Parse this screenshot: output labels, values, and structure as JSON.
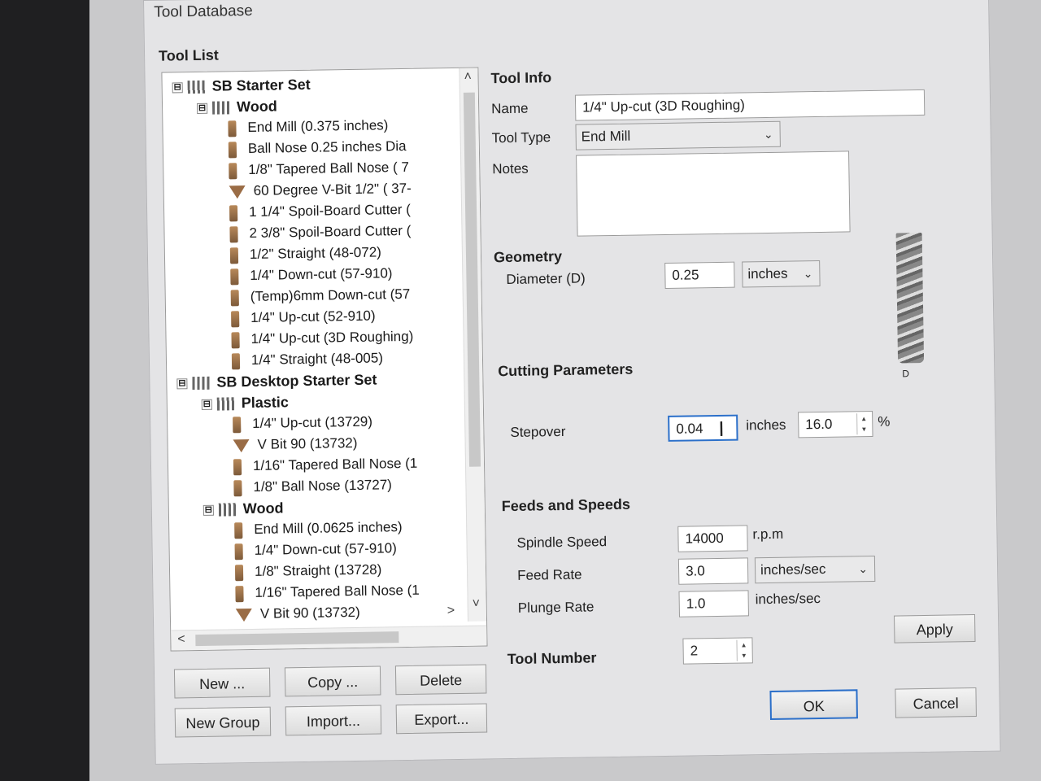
{
  "window": {
    "title": "Tool Database"
  },
  "tool_list": {
    "heading": "Tool List",
    "tree": [
      {
        "type": "group",
        "level": 0,
        "expand": "⊟",
        "label": "SB Starter Set"
      },
      {
        "type": "group",
        "level": 1,
        "expand": "⊟",
        "label": "Wood"
      },
      {
        "type": "tool",
        "level": 2,
        "icon": "end-mill-icon",
        "label": "End Mill (0.375 inches)"
      },
      {
        "type": "tool",
        "level": 2,
        "icon": "end-mill-icon",
        "label": "Ball Nose 0.25 inches Dia"
      },
      {
        "type": "tool",
        "level": 2,
        "icon": "end-mill-icon",
        "label": "1/8\" Tapered Ball Nose ( 7"
      },
      {
        "type": "tool",
        "level": 2,
        "icon": "v-bit-icon",
        "label": "60 Degree V-Bit 1/2\"  ( 37-"
      },
      {
        "type": "tool",
        "level": 2,
        "icon": "end-mill-icon",
        "label": "1 1/4\" Spoil-Board Cutter ("
      },
      {
        "type": "tool",
        "level": 2,
        "icon": "end-mill-icon",
        "label": "2 3/8\" Spoil-Board Cutter ("
      },
      {
        "type": "tool",
        "level": 2,
        "icon": "end-mill-icon",
        "label": "1/2\" Straight  (48-072)"
      },
      {
        "type": "tool",
        "level": 2,
        "icon": "end-mill-icon",
        "label": "1/4\"  Down-cut (57-910)"
      },
      {
        "type": "tool",
        "level": 2,
        "icon": "end-mill-icon",
        "label": "(Temp)6mm  Down-cut (57"
      },
      {
        "type": "tool",
        "level": 2,
        "icon": "end-mill-icon",
        "label": "1/4\" Up-cut (52-910)"
      },
      {
        "type": "tool",
        "level": 2,
        "icon": "end-mill-icon",
        "label": "1/4\" Up-cut (3D Roughing)"
      },
      {
        "type": "tool",
        "level": 2,
        "icon": "end-mill-icon",
        "label": "1/4\" Straight  (48-005)"
      },
      {
        "type": "group",
        "level": 0,
        "expand": "⊟",
        "label": "SB Desktop Starter Set"
      },
      {
        "type": "group",
        "level": 1,
        "expand": "⊟",
        "label": "Plastic"
      },
      {
        "type": "tool",
        "level": 2,
        "icon": "end-mill-icon",
        "label": "1/4\" Up-cut (13729)"
      },
      {
        "type": "tool",
        "level": 2,
        "icon": "v-bit-icon",
        "label": "V Bit 90 (13732)"
      },
      {
        "type": "tool",
        "level": 2,
        "icon": "end-mill-icon",
        "label": "1/16\" Tapered Ball Nose (1"
      },
      {
        "type": "tool",
        "level": 2,
        "icon": "end-mill-icon",
        "label": "1/8\" Ball Nose (13727)"
      },
      {
        "type": "group",
        "level": 1,
        "expand": "⊟",
        "label": "Wood"
      },
      {
        "type": "tool",
        "level": 2,
        "icon": "end-mill-icon",
        "label": "End Mill (0.0625 inches)"
      },
      {
        "type": "tool",
        "level": 2,
        "icon": "end-mill-icon",
        "label": "1/4\"  Down-cut (57-910)"
      },
      {
        "type": "tool",
        "level": 2,
        "icon": "end-mill-icon",
        "label": "1/8\" Straight (13728)"
      },
      {
        "type": "tool",
        "level": 2,
        "icon": "end-mill-icon",
        "label": "1/16\" Tapered Ball Nose (1"
      },
      {
        "type": "tool",
        "level": 2,
        "icon": "v-bit-icon",
        "label": "V Bit 90 (13732)"
      }
    ],
    "buttons": {
      "new": "New ...",
      "copy": "Copy ...",
      "delete": "Delete",
      "new_group": "New Group",
      "import": "Import...",
      "export": "Export..."
    }
  },
  "tool_info": {
    "heading": "Tool Info",
    "name_label": "Name",
    "name_value": "1/4\" Up-cut (3D Roughing)",
    "type_label": "Tool Type",
    "type_value": "End Mill",
    "notes_label": "Notes",
    "notes_value": ""
  },
  "geometry": {
    "heading": "Geometry",
    "diameter_label": "Diameter (D)",
    "diameter_value": "0.25",
    "units_value": "inches",
    "diagram_label": "D"
  },
  "cutting": {
    "heading": "Cutting Parameters",
    "stepover_label": "Stepover",
    "stepover_value": "0.04",
    "stepover_unit": "inches",
    "stepover_percent": "16.0",
    "percent_sign": "%"
  },
  "feeds": {
    "heading": "Feeds and Speeds",
    "spindle_label": "Spindle Speed",
    "spindle_value": "14000",
    "spindle_unit": "r.p.m",
    "feed_label": "Feed Rate",
    "feed_value": "3.0",
    "feed_unit": "inches/sec",
    "plunge_label": "Plunge Rate",
    "plunge_value": "1.0",
    "plunge_unit": "inches/sec",
    "apply": "Apply"
  },
  "tool_number": {
    "label": "Tool Number",
    "value": "2"
  },
  "footer": {
    "ok": "OK",
    "cancel": "Cancel"
  }
}
